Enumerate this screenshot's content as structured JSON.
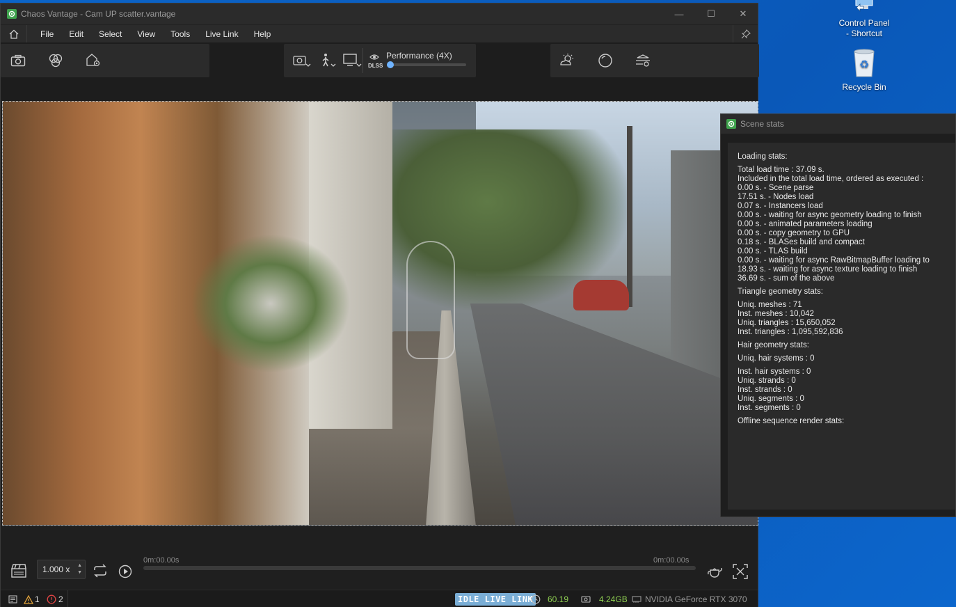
{
  "desktop": {
    "icons": [
      {
        "label_line1": "Control Panel",
        "label_line2": "- Shortcut"
      },
      {
        "label_line1": "Recycle Bin",
        "label_line2": ""
      }
    ]
  },
  "window": {
    "title": "Chaos Vantage - Cam UP scatter.vantage",
    "controls": {
      "minimize": "—",
      "maximize": "☐",
      "close": "✕"
    }
  },
  "menu": {
    "items": [
      "File",
      "Edit",
      "Select",
      "View",
      "Tools",
      "Live Link",
      "Help"
    ]
  },
  "toolbar": {
    "performance_label": "Performance (4X)",
    "dlss_label": "DLSS",
    "performance_slider_value": 0.0
  },
  "timeline": {
    "zoom_value": "1.000 x",
    "start_time": "0m:00.00s",
    "end_time": "0m:00.00s"
  },
  "statusbar": {
    "warnings_count": "1",
    "errors_count": "2",
    "live_link_status": "IDLE LIVE LINK",
    "fps": "60.19",
    "vram": "4.24GB",
    "gpu": "NVIDIA GeForce RTX 3070"
  },
  "scene_stats": {
    "title": "Scene stats",
    "lines": [
      "Loading stats:",
      "Total load time : 37.09 s.",
      "Included in the total load time, ordered as executed :",
      "0.00 s. - Scene parse",
      "17.51 s. - Nodes load",
      "0.07 s. - Instancers load",
      "0.00 s. - waiting for async geometry loading to finish",
      "0.00 s. - animated parameters loading",
      "0.00 s. - copy geometry to GPU",
      "0.18 s. - BLASes build and compact",
      "0.00 s. - TLAS build",
      "0.00 s. - waiting for async RawBitmapBuffer loading to",
      "18.93 s. - waiting for async texture loading to finish",
      "36.69 s. - sum of the above",
      "Triangle geometry stats:",
      "Uniq. meshes : 71",
      "Inst. meshes : 10,042",
      "Uniq. triangles : 15,650,052",
      "Inst. triangles : 1,095,592,836",
      "Hair geometry stats:",
      "Uniq. hair systems : 0",
      "Inst. hair systems : 0",
      "Uniq. strands : 0",
      "Inst. strands : 0",
      "Uniq. segments : 0",
      "Inst. segments : 0",
      "Offline sequence render stats:"
    ]
  },
  "colors": {
    "desktop": "#0a6fd0",
    "accent": "#6fb3ff",
    "live_link": "#7aaed6",
    "ok_green": "#8fcf52",
    "warning": "#e2a33a",
    "error": "#e04444"
  }
}
